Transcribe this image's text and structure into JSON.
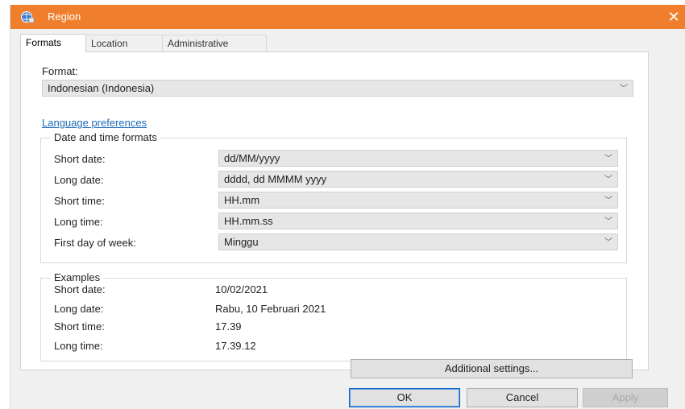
{
  "window": {
    "title": "Region",
    "close_glyph": "✕",
    "accent": "#f07f2d"
  },
  "tabs": [
    {
      "label": "Formats"
    },
    {
      "label": "Location"
    },
    {
      "label": "Administrative"
    }
  ],
  "format": {
    "label": "Format:",
    "value": "Indonesian (Indonesia)"
  },
  "language_link": "Language preferences",
  "date_time": {
    "legend": "Date and time formats",
    "rows": [
      {
        "label": "Short date:",
        "value": "dd/MM/yyyy"
      },
      {
        "label": "Long date:",
        "value": "dddd, dd MMMM yyyy"
      },
      {
        "label": "Short time:",
        "value": "HH.mm"
      },
      {
        "label": "Long time:",
        "value": "HH.mm.ss"
      },
      {
        "label": "First day of week:",
        "value": "Minggu"
      }
    ]
  },
  "examples": {
    "legend": "Examples",
    "rows": [
      {
        "label": "Short date:",
        "value": "10/02/2021"
      },
      {
        "label": "Long date:",
        "value": "Rabu, 10 Februari 2021"
      },
      {
        "label": "Short time:",
        "value": "17.39"
      },
      {
        "label": "Long time:",
        "value": "17.39.12"
      }
    ]
  },
  "buttons": {
    "additional": "Additional settings...",
    "ok": "OK",
    "cancel": "Cancel",
    "apply": "Apply"
  },
  "chevron_glyph": "﹀"
}
